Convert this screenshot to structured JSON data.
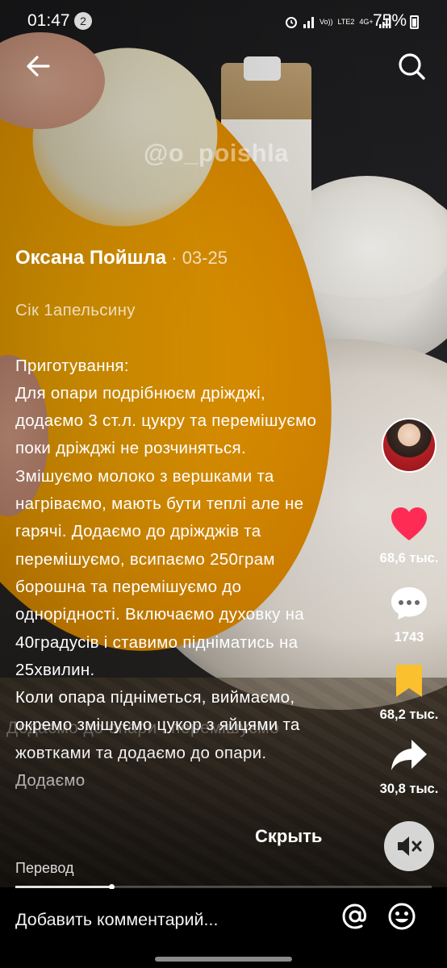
{
  "status_bar": {
    "time": "01:47",
    "notification_count": "2",
    "battery_percent": "75%",
    "network_labels": [
      "Vo))",
      "LTE2",
      "4G+"
    ]
  },
  "video": {
    "watermark": "@o_poishla",
    "subtitle_overlay_text": "Додаємо до опари і перемішуємо",
    "progress_fraction": 0.23
  },
  "post": {
    "author": "Оксана Пойшла",
    "date_separator": " · ",
    "date": "03-25",
    "caption_line1": "Сік 1апельсину",
    "caption_body": "Приготування:\nДля опари подрібнюєм дріжджі, додаємо 3 ст.л. цукру та перемішуємо поки дріжджі не розчиняться. Змішуємо молоко з вершками та нагріваємо, мають бути теплі але не гарячі. Додаємо до дріжджів та перемішуємо, всипаємо 250грам борошна та перемішуємо до однорідності. Включаємо духовку на 40градусів і ставимо підніматись на 25хвилин.\nКоли опара підніметься, виймаємо, окремо змішуємо цукор з яйцями та жовтками та додаємо до опари. Додаємо"
  },
  "actions": {
    "likes": "68,6 тыс.",
    "comments": "1743",
    "saves": "68,2 тыс.",
    "shares": "30,8 тыс."
  },
  "labels": {
    "hide": "Скрыть",
    "translate": "Перевод",
    "comment_placeholder": "Добавить комментарий..."
  },
  "icons": {
    "back": "arrow-left-icon",
    "search": "search-icon",
    "like": "heart-icon",
    "comment": "speech-bubble-icon",
    "save": "bookmark-icon",
    "share": "share-arrow-icon",
    "mute": "speaker-muted-icon",
    "mention": "at-sign-icon",
    "emoji": "smiley-icon"
  },
  "colors": {
    "like": "#fe2c55",
    "save": "#fbc02d",
    "rail_icon": "#ffffff"
  }
}
